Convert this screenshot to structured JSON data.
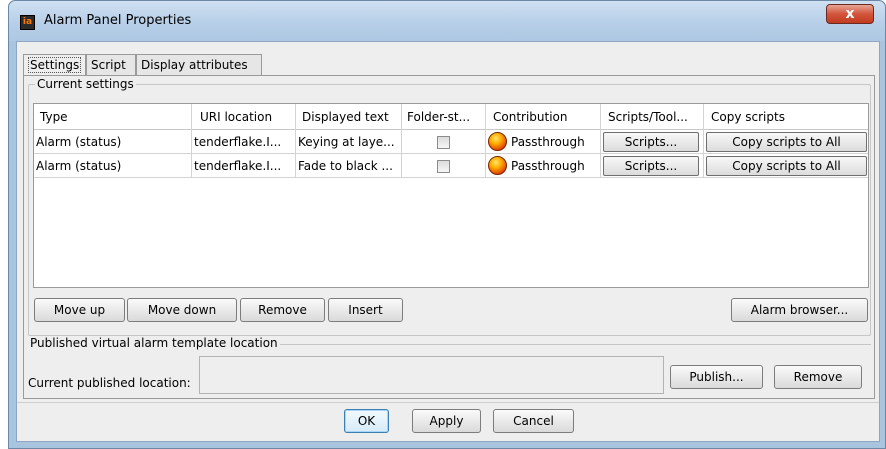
{
  "window": {
    "title": "Alarm Panel Properties",
    "app_icon_text": "ia",
    "close_glyph": "x"
  },
  "tabs": [
    {
      "label": "Settings"
    },
    {
      "label": "Script"
    },
    {
      "label": "Display attributes"
    }
  ],
  "current_settings": {
    "title": "Current settings",
    "columns": [
      "Type",
      "URI location",
      "Displayed text",
      "Folder-st...",
      "Contribution",
      "Scripts/Tool...",
      "Copy scripts"
    ],
    "rows": [
      {
        "type": "Alarm (status)",
        "uri": "tenderflake.I...",
        "text": "Keying at laye...",
        "folder_checked": false,
        "contribution": "Passthrough",
        "scripts_label": "Scripts...",
        "copy_label": "Copy scripts to All"
      },
      {
        "type": "Alarm (status)",
        "uri": "tenderflake.I...",
        "text": "Fade to black ...",
        "folder_checked": false,
        "contribution": "Passthrough",
        "scripts_label": "Scripts...",
        "copy_label": "Copy scripts to All"
      }
    ],
    "buttons": {
      "move_up": "Move up",
      "move_down": "Move down",
      "remove": "Remove",
      "insert": "Insert",
      "alarm_browser": "Alarm browser..."
    }
  },
  "published": {
    "title": "Published virtual alarm template location",
    "label": "Current published location:",
    "value": "",
    "publish": "Publish...",
    "remove": "Remove"
  },
  "footer": {
    "ok": "OK",
    "apply": "Apply",
    "cancel": "Cancel"
  },
  "colors": {
    "title_bar": "#b7cfe8",
    "close_button": "#c13a20",
    "default_button": "#3c7fb1",
    "status_orb": "#ff8a00"
  }
}
